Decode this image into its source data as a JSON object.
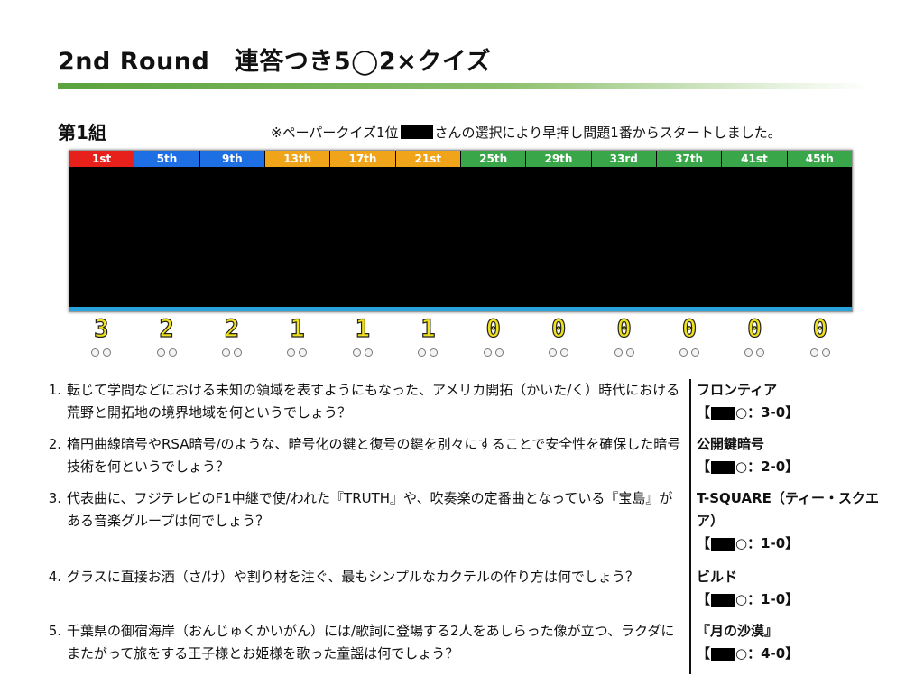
{
  "header": {
    "title": "2nd Round　連答つき5◯2×クイズ"
  },
  "group": {
    "label": "第1組",
    "notice_prefix": "※ペーパークイズ1位",
    "notice_suffix": "さんの選択により早押し問題1番からスタートしました。"
  },
  "board": {
    "seats": [
      {
        "rank": "1st",
        "color": "#e8201c",
        "score": "3"
      },
      {
        "rank": "5th",
        "color": "#1d6fe3",
        "score": "2"
      },
      {
        "rank": "9th",
        "color": "#1d6fe3",
        "score": "2"
      },
      {
        "rank": "13th",
        "color": "#f0a41a",
        "score": "1"
      },
      {
        "rank": "17th",
        "color": "#f0a41a",
        "score": "1"
      },
      {
        "rank": "21st",
        "color": "#f0a41a",
        "score": "1"
      },
      {
        "rank": "25th",
        "color": "#3aa64a",
        "score": "0"
      },
      {
        "rank": "29th",
        "color": "#3aa64a",
        "score": "0"
      },
      {
        "rank": "33rd",
        "color": "#3aa64a",
        "score": "0"
      },
      {
        "rank": "37th",
        "color": "#3aa64a",
        "score": "0"
      },
      {
        "rank": "41st",
        "color": "#3aa64a",
        "score": "0"
      },
      {
        "rank": "45th",
        "color": "#3aa64a",
        "score": "0"
      }
    ]
  },
  "questions": [
    {
      "num": "1.",
      "text": "転じて学問などにおける未知の領域を表すようにもなった、アメリカ開拓（かいた/く）時代における荒野と開拓地の境界地域を何というでしょう？",
      "answer": "フロンティア",
      "result_open": "【",
      "result_mark": "○：3-0】"
    },
    {
      "num": "2.",
      "text": "楕円曲線暗号やRSA暗号/のような、暗号化の鍵と復号の鍵を別々にすることで安全性を確保した暗号技術を何というでしょう？",
      "answer": "公開鍵暗号",
      "result_open": "【",
      "result_mark": "○：2-0】"
    },
    {
      "num": "3.",
      "text": "代表曲に、フジテレビのF1中継で使/われた『TRUTH』や、吹奏楽の定番曲となっている『宝島』がある音楽グループは何でしょう？",
      "answer": "T-SQUARE（ティー・スクエア）",
      "result_open": "【",
      "result_mark": "○：1-0】"
    },
    {
      "num": "4.",
      "text": "グラスに直接お酒（さ/け）や割り材を注ぐ、最もシンプルなカクテルの作り方は何でしょう？",
      "answer": "ビルド",
      "result_open": "【",
      "result_mark": "○：1-0】"
    },
    {
      "num": "5.",
      "text": "千葉県の御宿海岸（おんじゅくかいがん）には/歌詞に登場する2人をあしらった像が立つ、ラクダにまたがって旅をする王子様とお姫様を歌った童謡は何でしょう？",
      "answer": "『月の沙漠』",
      "result_open": "【",
      "result_mark": "○：4-0】"
    }
  ]
}
